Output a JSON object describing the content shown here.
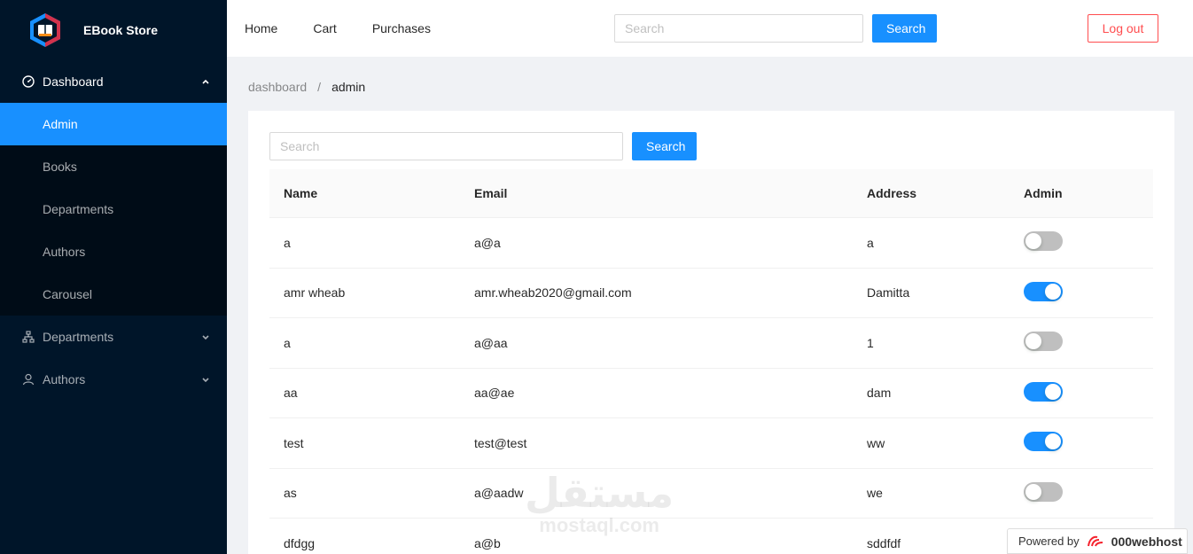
{
  "app": {
    "title": "EBook Store"
  },
  "sidebar": {
    "dashboard": {
      "label": "Dashboard"
    },
    "submenu": [
      {
        "label": "Admin",
        "selected": true
      },
      {
        "label": "Books"
      },
      {
        "label": "Departments"
      },
      {
        "label": "Authors"
      },
      {
        "label": "Carousel"
      }
    ],
    "departments": {
      "label": "Departments"
    },
    "authors": {
      "label": "Authors"
    }
  },
  "header": {
    "nav": [
      {
        "label": "Home"
      },
      {
        "label": "Cart"
      },
      {
        "label": "Purchases"
      }
    ],
    "search_placeholder": "Search",
    "search_button": "Search",
    "logout_label": "Log out"
  },
  "breadcrumb": {
    "parent": "dashboard",
    "separator": "/",
    "current": "admin"
  },
  "content": {
    "search_placeholder": "Search",
    "search_button": "Search",
    "table": {
      "columns": [
        "Name",
        "Email",
        "Address",
        "Admin"
      ],
      "rows": [
        {
          "name": "a",
          "email": "a@a",
          "address": "a",
          "admin": false
        },
        {
          "name": "amr wheab",
          "email": "amr.wheab2020@gmail.com",
          "address": "Damitta",
          "admin": true
        },
        {
          "name": "a",
          "email": "a@aa",
          "address": "1",
          "admin": false
        },
        {
          "name": "aa",
          "email": "aa@ae",
          "address": "dam",
          "admin": true
        },
        {
          "name": "test",
          "email": "test@test",
          "address": "ww",
          "admin": true
        },
        {
          "name": "as",
          "email": "a@aadw",
          "address": "we",
          "admin": false
        },
        {
          "name": "dfdgg",
          "email": "a@b",
          "address": "sddfdf",
          "admin": false
        }
      ]
    }
  },
  "watermark": {
    "arabic": "مستقل",
    "latin": "mostaql.com"
  },
  "powered": {
    "prefix": "Powered by",
    "brand": "000webhost"
  },
  "colors": {
    "sidebar": "#001529",
    "primary": "#1890ff",
    "danger": "#ff4d4f"
  }
}
